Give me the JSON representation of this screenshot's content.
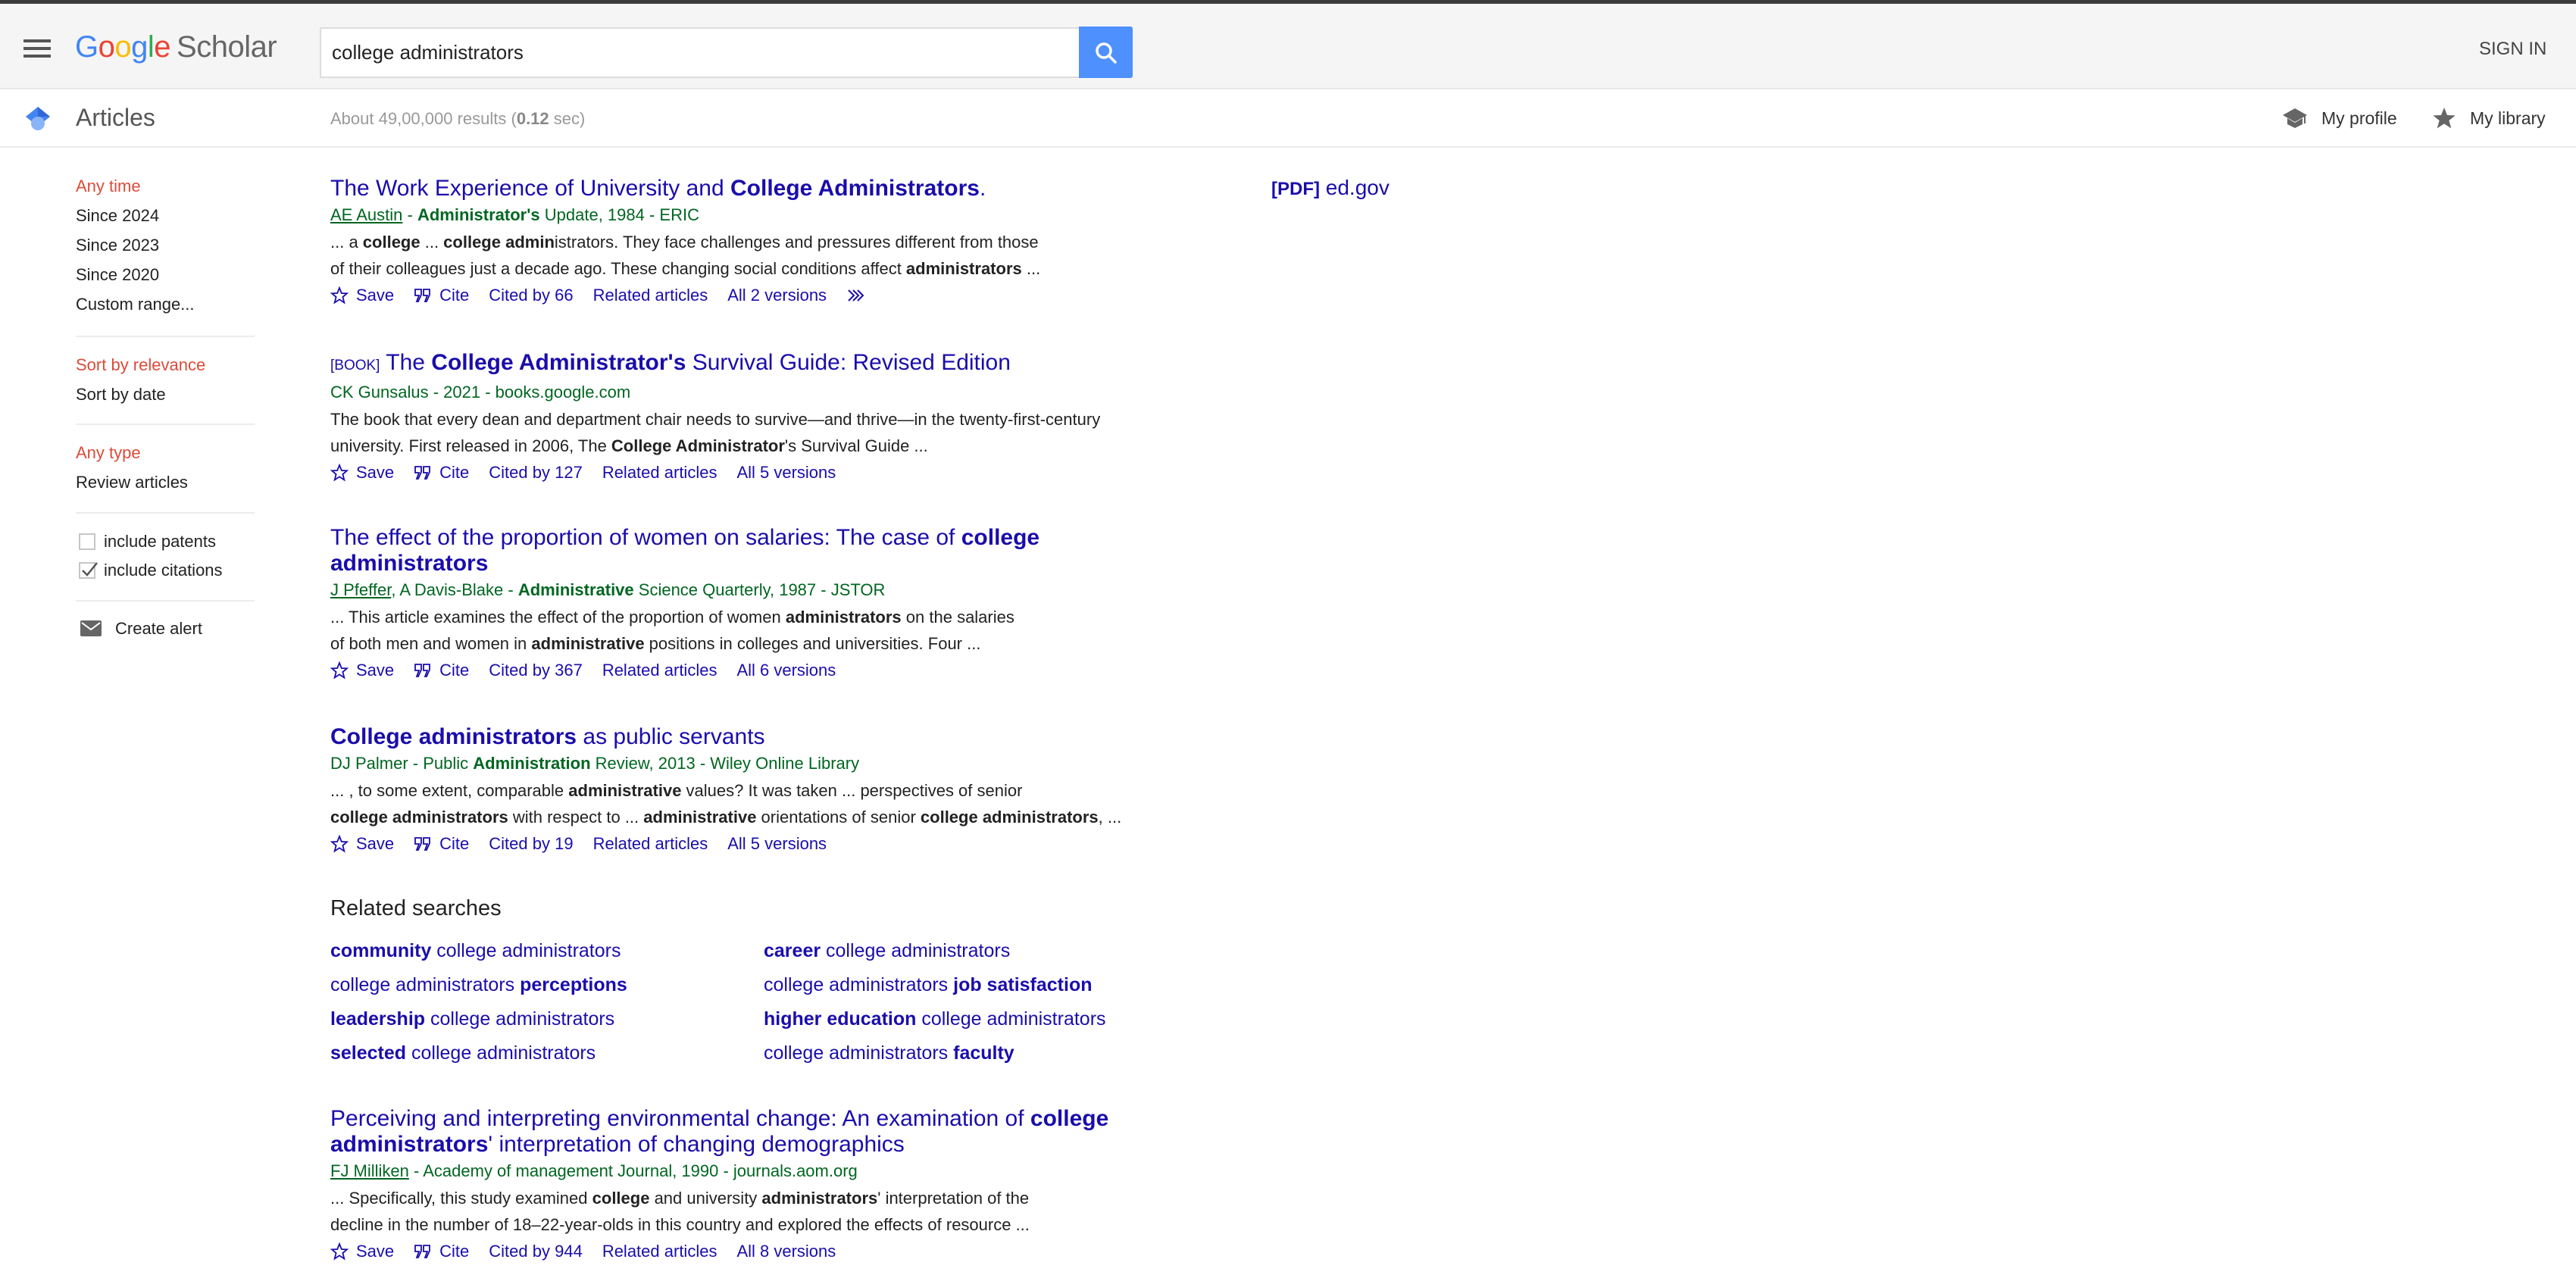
{
  "header": {
    "logo_google": [
      "G",
      "o",
      "o",
      "g",
      "l",
      "e"
    ],
    "logo_scholar": "Scholar",
    "search_value": "college administrators",
    "search_placeholder": "",
    "sign_in": "SIGN IN"
  },
  "subheader": {
    "section": "Articles",
    "results_prefix": "About 49,00,000 results (",
    "results_time": "0.12",
    "results_suffix": " sec)",
    "my_profile": "My profile",
    "my_library": "My library"
  },
  "sidebar": {
    "time": [
      {
        "label": "Any time",
        "active": true
      },
      {
        "label": "Since 2024",
        "active": false
      },
      {
        "label": "Since 2023",
        "active": false
      },
      {
        "label": "Since 2020",
        "active": false
      },
      {
        "label": "Custom range...",
        "active": false
      }
    ],
    "sort": [
      {
        "label": "Sort by relevance",
        "active": true
      },
      {
        "label": "Sort by date",
        "active": false
      }
    ],
    "type": [
      {
        "label": "Any type",
        "active": true
      },
      {
        "label": "Review articles",
        "active": false
      }
    ],
    "checkboxes": [
      {
        "label": "include patents",
        "checked": false
      },
      {
        "label": "include citations",
        "checked": true
      }
    ],
    "create_alert": "Create alert"
  },
  "colors": {
    "link": "#1a0dab",
    "meta_green": "#006621",
    "active_red": "#dd4b39",
    "search_button": "#4d90fe"
  },
  "results": [
    {
      "tag": "",
      "title_parts": [
        [
          "The Work Experience of University and ",
          false
        ],
        [
          "College Administrators",
          true
        ],
        [
          ".",
          false
        ]
      ],
      "meta_parts": [
        [
          "AE Austin",
          "link"
        ],
        [
          " - ",
          ""
        ],
        [
          "Administrator's",
          "bold"
        ],
        [
          " Update, 1984 - ERIC",
          ""
        ]
      ],
      "snippet_lines": [
        [
          [
            "... a ",
            false
          ],
          [
            "college",
            true
          ],
          [
            " ... ",
            false
          ],
          [
            "college admin",
            true
          ],
          [
            "istrators. They face challenges and pressures different from those",
            false
          ]
        ],
        [
          [
            "of their colleagues just a decade ago. These changing social conditions affect ",
            false
          ],
          [
            "administrators",
            true
          ],
          [
            " ...",
            false
          ]
        ]
      ],
      "actions": {
        "save": "Save",
        "cite": "Cite",
        "cited_by": "Cited by 66",
        "related": "Related articles",
        "versions": "All 2 versions"
      },
      "has_more": true,
      "side_link": {
        "tag": "[PDF]",
        "domain": "ed.gov"
      }
    },
    {
      "tag": "[BOOK]",
      "title_parts": [
        [
          "The ",
          false
        ],
        [
          "College Administrator's",
          true
        ],
        [
          " Survival Guide: Revised Edition",
          false
        ]
      ],
      "meta_parts": [
        [
          "CK Gunsalus - 2021 - books.google.com",
          ""
        ]
      ],
      "snippet_lines": [
        [
          [
            "The book that every dean and department chair needs to survive—and thrive—in the twenty-first-century",
            false
          ]
        ],
        [
          [
            "university. First released in 2006, The ",
            false
          ],
          [
            "College Administrator",
            true
          ],
          [
            "'s Survival Guide ...",
            false
          ]
        ]
      ],
      "actions": {
        "save": "Save",
        "cite": "Cite",
        "cited_by": "Cited by 127",
        "related": "Related articles",
        "versions": "All 5 versions"
      },
      "has_more": false
    },
    {
      "tag": "",
      "title_parts": [
        [
          "The effect of the proportion of women on salaries: The case of ",
          false
        ],
        [
          "college administrators",
          true
        ]
      ],
      "meta_parts": [
        [
          "J Pfeffer",
          "link"
        ],
        [
          ", A Davis-Blake - ",
          ""
        ],
        [
          "Administrative",
          "bold"
        ],
        [
          " Science Quarterly, 1987 - JSTOR",
          ""
        ]
      ],
      "snippet_lines": [
        [
          [
            "... This article examines the effect of the proportion of women ",
            false
          ],
          [
            "administrators",
            true
          ],
          [
            " on the salaries",
            false
          ]
        ],
        [
          [
            "of both men and women in ",
            false
          ],
          [
            "administrative",
            true
          ],
          [
            " positions in colleges and universities. Four ...",
            false
          ]
        ]
      ],
      "actions": {
        "save": "Save",
        "cite": "Cite",
        "cited_by": "Cited by 367",
        "related": "Related articles",
        "versions": "All 6 versions"
      },
      "has_more": false
    },
    {
      "tag": "",
      "title_parts": [
        [
          "College administrators",
          true
        ],
        [
          " as public servants",
          false
        ]
      ],
      "meta_parts": [
        [
          "DJ Palmer - Public ",
          ""
        ],
        [
          "Administration",
          "bold"
        ],
        [
          " Review, 2013 - Wiley Online Library",
          ""
        ]
      ],
      "snippet_lines": [
        [
          [
            "... , to some extent, comparable ",
            false
          ],
          [
            "administrative",
            true
          ],
          [
            " values? It was taken ... perspectives of senior",
            false
          ]
        ],
        [
          [
            "college administrators",
            true
          ],
          [
            " with respect to ... ",
            false
          ],
          [
            "administrative",
            true
          ],
          [
            " orientations of senior ",
            false
          ],
          [
            "college administrators",
            true
          ],
          [
            ", ...",
            false
          ]
        ]
      ],
      "actions": {
        "save": "Save",
        "cite": "Cite",
        "cited_by": "Cited by 19",
        "related": "Related articles",
        "versions": "All 5 versions"
      },
      "has_more": false
    },
    {
      "tag": "",
      "title_parts": [
        [
          "Perceiving and interpreting environmental change: An examination of ",
          false
        ],
        [
          "college administrators",
          true
        ],
        [
          "' interpretation of changing demographics",
          false
        ]
      ],
      "meta_parts": [
        [
          "FJ Milliken",
          "link"
        ],
        [
          " - Academy of management Journal, 1990 - journals.aom.org",
          ""
        ]
      ],
      "snippet_lines": [
        [
          [
            "... Specifically, this study examined ",
            false
          ],
          [
            "college",
            true
          ],
          [
            " and university ",
            false
          ],
          [
            "administrators",
            true
          ],
          [
            "' interpretation of the",
            false
          ]
        ],
        [
          [
            "decline in the number of 18–22-year-olds in this country and explored the effects of resource ...",
            false
          ]
        ]
      ],
      "actions": {
        "save": "Save",
        "cite": "Cite",
        "cited_by": "Cited by 944",
        "related": "Related articles",
        "versions": "All 8 versions"
      },
      "has_more": false
    }
  ],
  "related_searches": {
    "heading": "Related searches",
    "items": [
      [
        [
          "community",
          true
        ],
        [
          " college administrators",
          false
        ]
      ],
      [
        [
          "career",
          true
        ],
        [
          " college administrators",
          false
        ]
      ],
      [
        [
          "college administrators ",
          false
        ],
        [
          "perceptions",
          true
        ]
      ],
      [
        [
          "college administrators ",
          false
        ],
        [
          "job satisfaction",
          true
        ]
      ],
      [
        [
          "leadership",
          true
        ],
        [
          " college administrators",
          false
        ]
      ],
      [
        [
          "higher education",
          true
        ],
        [
          " college administrators",
          false
        ]
      ],
      [
        [
          "selected",
          true
        ],
        [
          " college administrators",
          false
        ]
      ],
      [
        [
          "college administrators ",
          false
        ],
        [
          "faculty",
          true
        ]
      ]
    ]
  }
}
